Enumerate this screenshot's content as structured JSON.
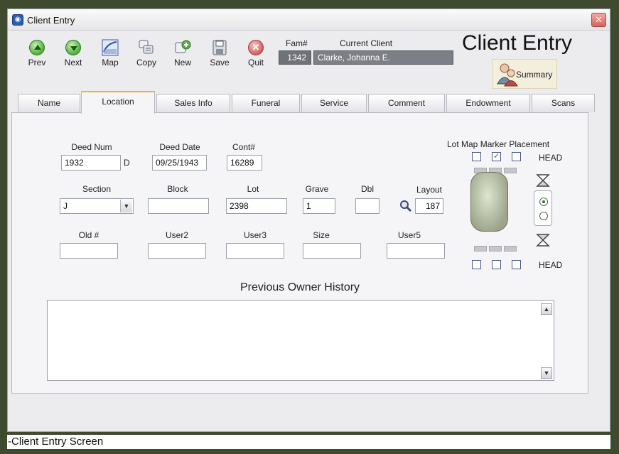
{
  "window": {
    "title": "Client Entry"
  },
  "toolbar": {
    "buttons": [
      {
        "label": "Prev"
      },
      {
        "label": "Next"
      },
      {
        "label": "Map"
      },
      {
        "label": "Copy"
      },
      {
        "label": "New"
      },
      {
        "label": "Save"
      },
      {
        "label": "Quit"
      }
    ]
  },
  "header": {
    "fam_label": "Fam#",
    "current_client_label": "Current Client",
    "fam_value": "1342",
    "client_value": "Clarke, Johanna E.",
    "big_title": "Client Entry",
    "summary_label": "Summary"
  },
  "tabs": [
    {
      "label": "Name"
    },
    {
      "label": "Location",
      "active": true
    },
    {
      "label": "Sales Info"
    },
    {
      "label": "Funeral"
    },
    {
      "label": "Service"
    },
    {
      "label": "Comment"
    },
    {
      "label": "Endowment"
    },
    {
      "label": "Scans"
    }
  ],
  "location": {
    "deed_num": {
      "label": "Deed Num",
      "value": "1932",
      "suffix": "D"
    },
    "deed_date": {
      "label": "Deed Date",
      "value": "09/25/1943"
    },
    "cont": {
      "label": "Cont#",
      "value": "16289"
    },
    "section": {
      "label": "Section",
      "value": "J"
    },
    "block": {
      "label": "Block",
      "value": ""
    },
    "lot": {
      "label": "Lot",
      "value": "2398"
    },
    "grave": {
      "label": "Grave",
      "value": "1"
    },
    "dbl": {
      "label": "Dbl",
      "value": ""
    },
    "layout": {
      "label": "Layout",
      "value": "187"
    },
    "old": {
      "label": "Old #",
      "value": ""
    },
    "user2": {
      "label": "User2",
      "value": ""
    },
    "user3": {
      "label": "User3",
      "value": ""
    },
    "size": {
      "label": "Size",
      "value": ""
    },
    "user5": {
      "label": "User5",
      "value": ""
    }
  },
  "marker": {
    "title": "Lot Map Marker Placement",
    "head_top": "HEAD",
    "head_bottom": "HEAD",
    "top_checks": [
      false,
      true,
      false
    ],
    "bottom_checks": [
      false,
      false,
      false
    ],
    "radio_selected": 0
  },
  "history": {
    "title": "Previous Owner History"
  },
  "caption": "-Client Entry Screen"
}
